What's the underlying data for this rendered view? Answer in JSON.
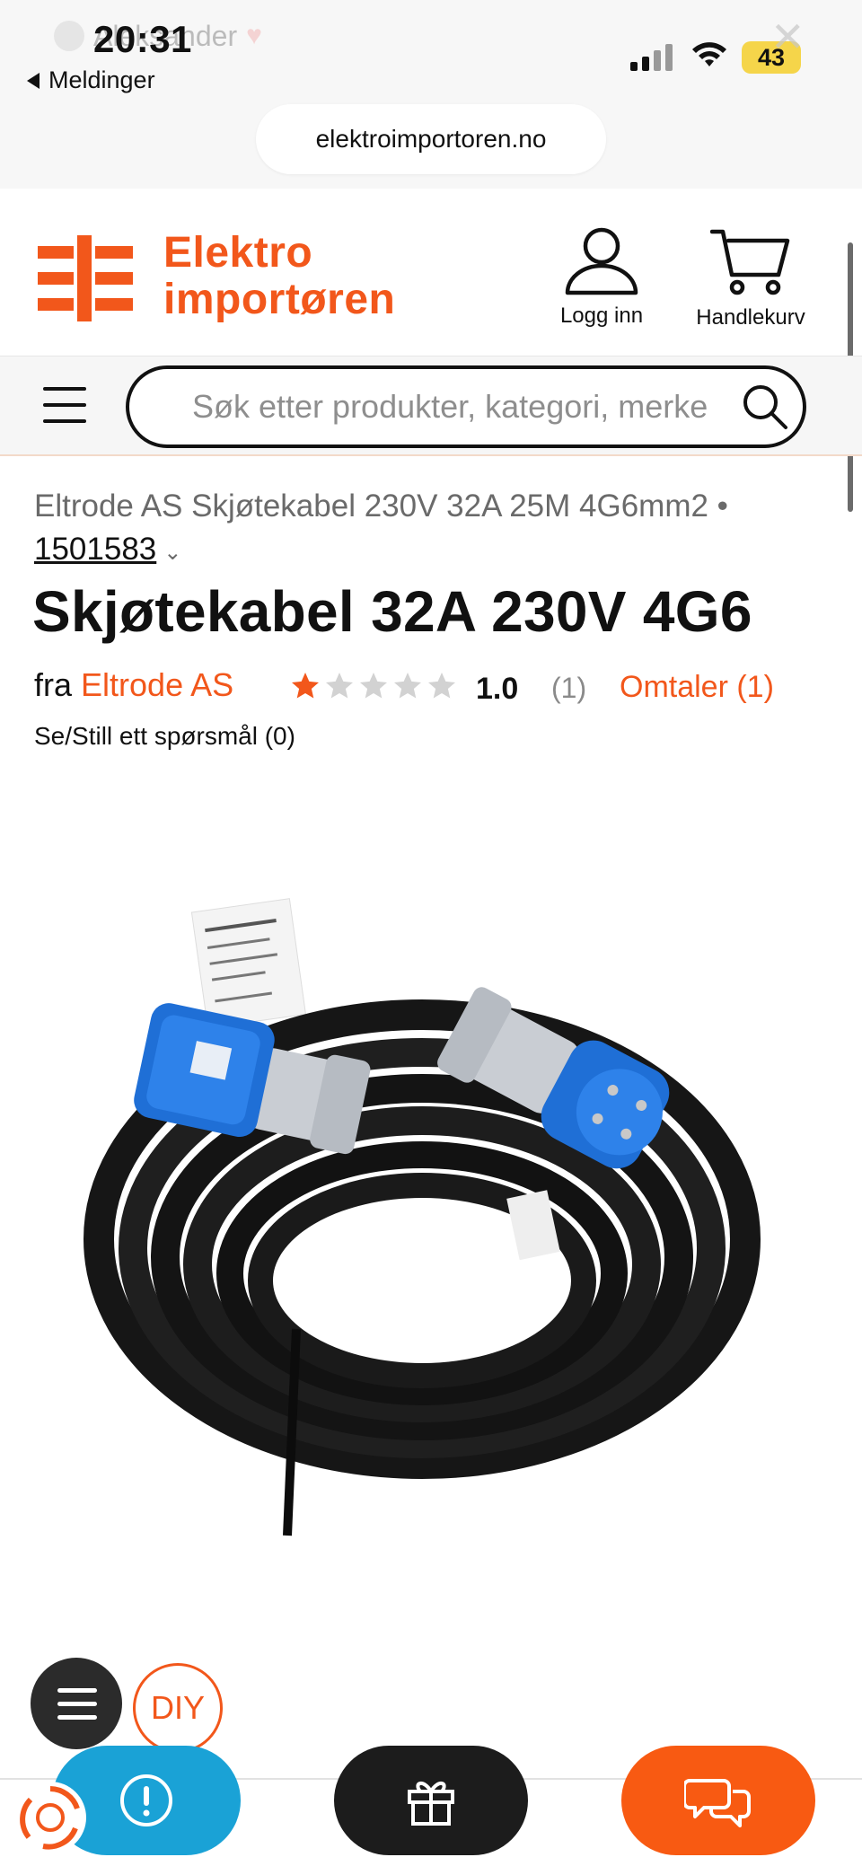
{
  "status_bar": {
    "notification_ghost_text": "Aleksander",
    "time": "20:31",
    "back_label": "Meldinger",
    "battery": "43"
  },
  "browser": {
    "url": "elektroimportoren.no"
  },
  "header": {
    "logo_line1": "Elektro",
    "logo_line2": "importøren",
    "login_label": "Logg inn",
    "cart_label": "Handlekurv",
    "brand_color": "#f2571b"
  },
  "search": {
    "placeholder": "Søk etter produkter, kategori, merke"
  },
  "product": {
    "breadcrumb": "Eltrode AS Skjøtekabel 230V 32A 25M 4G6mm2 •",
    "sku": "1501583",
    "title": "Skjøtekabel 32A 230V 4G6",
    "by_prefix": "fra",
    "brand": "Eltrode AS",
    "rating_value": "1.0",
    "rating_fill_stars": 1,
    "rating_max_stars": 5,
    "rating_count": "(1)",
    "reviews_label": "Omtaler (1)",
    "question_label": "Se/Still ett spørsmål (0)"
  },
  "floating": {
    "diy_label": "DIY"
  },
  "icons": {
    "menu": "hamburger-icon",
    "search": "search-icon",
    "user": "user-icon",
    "cart": "cart-icon",
    "info": "info-icon",
    "gift": "gift-icon",
    "chat": "chat-icon"
  }
}
